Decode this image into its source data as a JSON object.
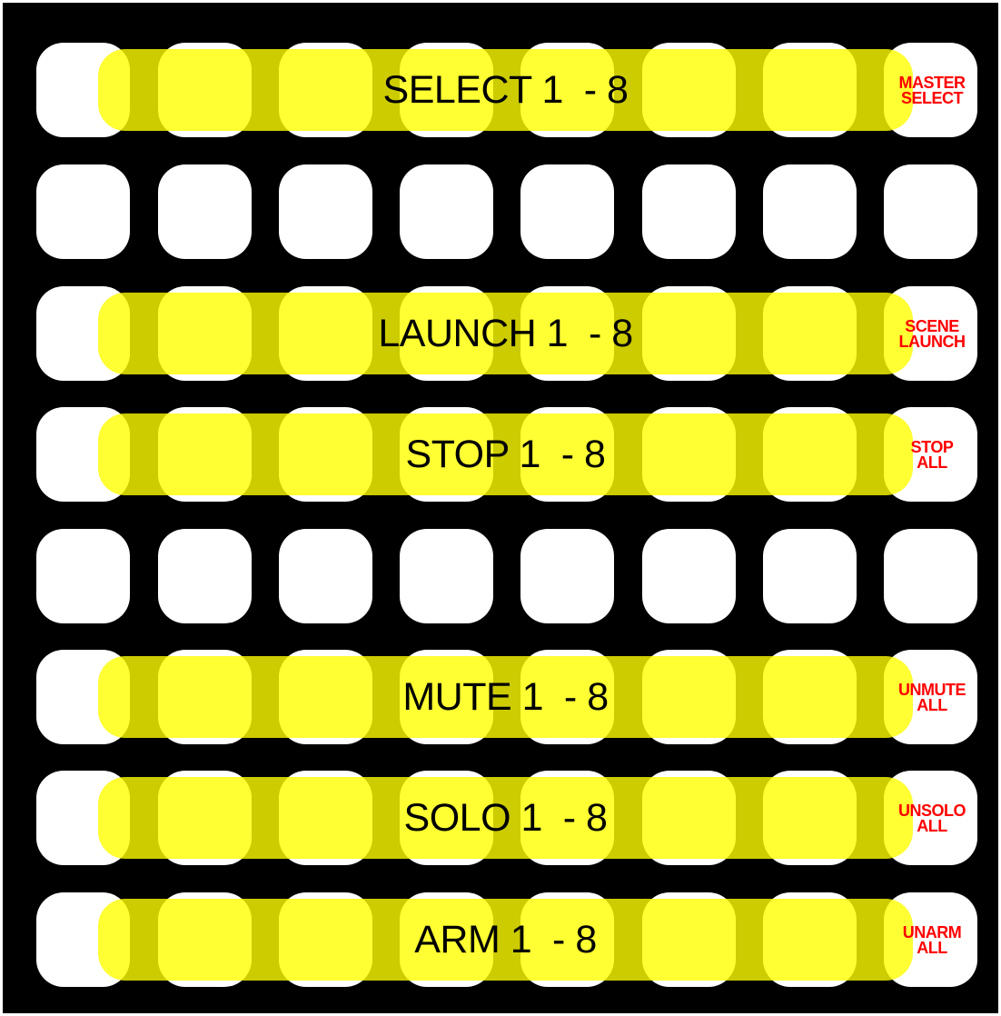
{
  "colors": {
    "background": "#000000",
    "pad": "#ffffff",
    "band": "#ffff00",
    "band_text": "#000000",
    "side_text": "#ff0000"
  },
  "grid": {
    "rows": 8,
    "columns": 8
  },
  "rows": [
    {
      "band_label": "SELECT 1  - 8",
      "side_label": [
        "MASTER",
        "SELECT"
      ]
    },
    {
      "band_label": null,
      "side_label": null
    },
    {
      "band_label": "LAUNCH 1  - 8",
      "side_label": [
        "SCENE",
        "LAUNCH"
      ]
    },
    {
      "band_label": "STOP 1  - 8",
      "side_label": [
        "STOP",
        "ALL"
      ]
    },
    {
      "band_label": null,
      "side_label": null
    },
    {
      "band_label": "MUTE 1  - 8",
      "side_label": [
        "UNMUTE",
        "ALL"
      ]
    },
    {
      "band_label": "SOLO 1  - 8",
      "side_label": [
        "UNSOLO",
        "ALL"
      ]
    },
    {
      "band_label": "ARM 1  - 8",
      "side_label": [
        "UNARM",
        "ALL"
      ]
    }
  ]
}
